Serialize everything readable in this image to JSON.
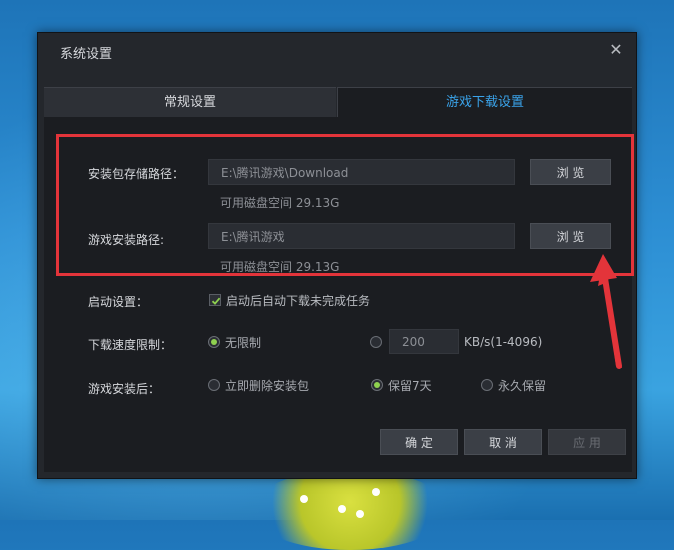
{
  "dialog": {
    "title": "系统设置",
    "close_symbol": "✕"
  },
  "tabs": [
    {
      "label": "常规设置",
      "active": false
    },
    {
      "label": "游戏下载设置",
      "active": true
    }
  ],
  "download": {
    "package_path_label": "安装包存储路径：",
    "package_path_value": "E:\\腾讯游戏\\Download",
    "package_browse": "浏 览",
    "package_free_space": "可用磁盘空间 29.13G",
    "install_path_label": "游戏安装路径:",
    "install_path_value": "E:\\腾讯游戏",
    "install_browse": "浏 览",
    "install_free_space": "可用磁盘空间 29.13G"
  },
  "startup": {
    "label": "启动设置：",
    "checkbox_label": "启动后自动下载未完成任务",
    "checked": true
  },
  "speed": {
    "label": "下载速度限制：",
    "option_unlimited": "无限制",
    "limit_value": "200",
    "unit": "KB/s(1-4096)"
  },
  "after_install": {
    "label": "游戏安装后：",
    "option_delete": "立即删除安装包",
    "option_keep7": "保留7天",
    "option_keep_forever": "永久保留"
  },
  "footer": {
    "confirm": "确 定",
    "cancel": "取 消",
    "apply": "应 用"
  },
  "colors": {
    "highlight_border": "#e3343a",
    "active_tab": "#3aa3ea",
    "radio_on": "#8fd14f"
  }
}
